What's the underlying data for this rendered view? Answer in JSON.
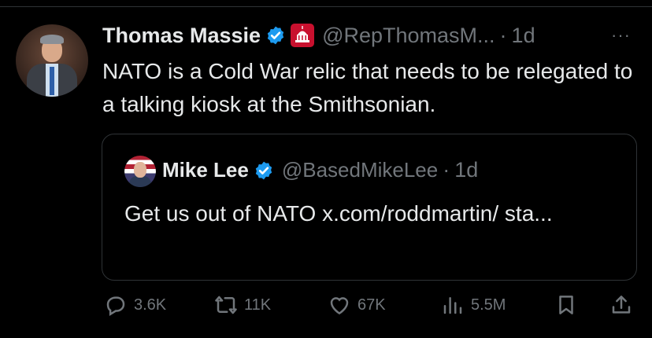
{
  "tweet": {
    "author_name": "Thomas Massie",
    "handle": "@RepThomasM...",
    "separator": "·",
    "time": "1d",
    "more": "···",
    "text": "NATO is a Cold War relic that needs to be relegated to a talking kiosk at the Smithsonian."
  },
  "quoted": {
    "author_name": "Mike Lee",
    "handle": "@BasedMikeLee",
    "separator": "·",
    "time": "1d",
    "text": "Get us out of NATO x.com/roddmartin/ sta..."
  },
  "actions": {
    "replies": "3.6K",
    "reposts": "11K",
    "likes": "67K",
    "views": "5.5M"
  },
  "icons": {
    "verified": "verified-badge-icon",
    "affiliation": "us-house-capitol-icon",
    "reply": "reply-icon",
    "repost": "repost-icon",
    "like": "heart-icon",
    "views": "views-icon",
    "bookmark": "bookmark-icon",
    "share": "share-icon"
  },
  "colors": {
    "background": "#000000",
    "text": "#e7e9ea",
    "muted": "#71767b",
    "verified": "#1d9bf0",
    "border": "#2f3336",
    "house_red": "#c8102e"
  }
}
